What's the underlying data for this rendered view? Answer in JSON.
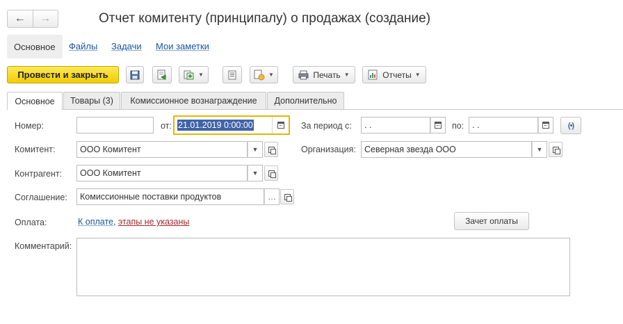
{
  "window": {
    "title": "Отчет комитенту (принципалу) о продажах (создание)",
    "nav_back": "←",
    "nav_forward": "→"
  },
  "sections": {
    "active": "Основное",
    "links": [
      "Файлы",
      "Задачи",
      "Мои заметки"
    ]
  },
  "toolbar": {
    "post_close_label": "Провести и закрыть",
    "print_label": "Печать",
    "reports_label": "Отчеты",
    "icons": [
      "save-icon",
      "post-icon",
      "create-based-on-icon",
      "list-icon",
      "attach-icon",
      "printer-icon",
      "reports-icon"
    ]
  },
  "tabs": [
    "Основное",
    "Товары (3)",
    "Комиссионное вознаграждение",
    "Дополнительно"
  ],
  "form": {
    "number_label": "Номер:",
    "number_value": "",
    "from_label": "от:",
    "date_value": "21.01.2019  0:00:00",
    "period_label": "За период с:",
    "period_from": " .  .",
    "period_to_label": "по:",
    "period_to": " .  .",
    "principal_label": "Комитент:",
    "principal_value": "ООО Комитент",
    "organization_label": "Организация:",
    "organization_value": "Северная звезда ООО",
    "counterparty_label": "Контрагент:",
    "counterparty_value": "ООО Комитент",
    "agreement_label": "Соглашение:",
    "agreement_value": "Комиссионные поставки продуктов",
    "payment_label": "Оплата:",
    "payment_link_blue": "К оплате,",
    "payment_link_red": "этапы не указаны",
    "payment_offset_button": "Зачет оплаты",
    "comment_label": "Комментарий:",
    "comment_value": ""
  },
  "colors": {
    "primary_button": "#f7d92a",
    "link": "#1a54a0",
    "warning_link": "#a52a2a",
    "focus_border": "#e6b800",
    "selection": "#3f63a8"
  }
}
